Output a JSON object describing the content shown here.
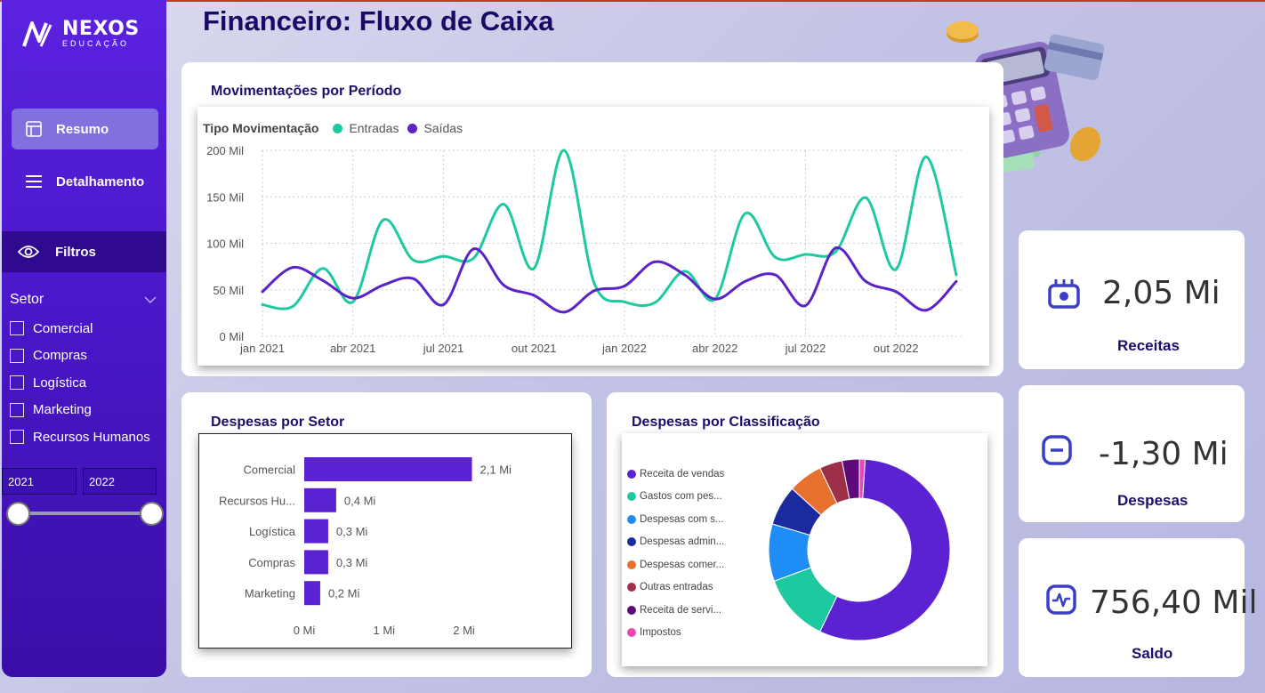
{
  "brand": {
    "name": "NEXOS",
    "sub": "EDUCAÇÃO"
  },
  "page": {
    "title": "Financeiro: Fluxo de Caixa"
  },
  "sidebar": {
    "nav": [
      {
        "label": "Resumo",
        "icon": "layout-icon",
        "active": true
      },
      {
        "label": "Detalhamento",
        "icon": "menu-icon",
        "active": false
      }
    ],
    "filters_label": "Filtros",
    "setor_label": "Setor",
    "setor_options": [
      "Comercial",
      "Compras",
      "Logística",
      "Marketing",
      "Recursos Humanos"
    ],
    "year_from": "2021",
    "year_to": "2022"
  },
  "line_card": {
    "title": "Movimentações por Período",
    "legend_title": "Tipo Movimentação",
    "series_names": [
      "Entradas",
      "Saídas"
    ]
  },
  "bar_card": {
    "title": "Despesas por Setor"
  },
  "donut_card": {
    "title": "Despesas por Classificação"
  },
  "colors": {
    "entradas": "#1ec9a0",
    "saidas": "#5b22c9",
    "bar": "#5b22d1",
    "title": "#1a0a66"
  },
  "kpis": [
    {
      "value": "2,05 Mi",
      "label": "Receitas",
      "icon": "wallet-icon"
    },
    {
      "value": "-1,30 Mi",
      "label": "Despesas",
      "icon": "minus-icon"
    },
    {
      "value": "756,40 Mil",
      "label": "Saldo",
      "icon": "pulse-icon"
    }
  ],
  "chart_data": [
    {
      "type": "line",
      "x": [
        "jan 2021",
        "fev 2021",
        "mar 2021",
        "abr 2021",
        "mai 2021",
        "jun 2021",
        "jul 2021",
        "ago 2021",
        "set 2021",
        "out 2021",
        "nov 2021",
        "dez 2021",
        "jan 2022",
        "fev 2022",
        "mar 2022",
        "abr 2022",
        "mai 2022",
        "jun 2022",
        "jul 2022",
        "ago 2022",
        "set 2022",
        "out 2022",
        "nov 2022",
        "dez 2022"
      ],
      "x_tick_labels": [
        "jan 2021",
        "abr 2021",
        "jul 2021",
        "out 2021",
        "jan 2022",
        "abr 2022",
        "jul 2022",
        "out 2022"
      ],
      "series": [
        {
          "name": "Entradas",
          "color": "#1ec9a0",
          "values": [
            34,
            32,
            73,
            37,
            125,
            82,
            86,
            84,
            142,
            73,
            200,
            57,
            37,
            36,
            70,
            40,
            132,
            85,
            88,
            91,
            149,
            72,
            193,
            66
          ]
        },
        {
          "name": "Saídas",
          "color": "#5b22c9",
          "values": [
            48,
            74,
            60,
            41,
            55,
            62,
            34,
            94,
            55,
            44,
            26,
            49,
            54,
            80,
            66,
            40,
            59,
            66,
            33,
            95,
            59,
            48,
            28,
            59
          ]
        }
      ],
      "y_ticks": [
        "0 Mil",
        "50 Mil",
        "100 Mil",
        "150 Mil",
        "200 Mil"
      ],
      "ylim": [
        0,
        200
      ],
      "grid": true,
      "legend_position": "top-left"
    },
    {
      "type": "bar",
      "orientation": "horizontal",
      "categories": [
        "Comercial",
        "Recursos Hu...",
        "Logística",
        "Compras",
        "Marketing"
      ],
      "values": [
        2.1,
        0.4,
        0.3,
        0.3,
        0.2
      ],
      "data_labels": [
        "2,1 Mi",
        "0,4 Mi",
        "0,3 Mi",
        "0,3 Mi",
        "0,2 Mi"
      ],
      "x_ticks": [
        "0 Mi",
        "1 Mi",
        "2 Mi"
      ],
      "xlim": [
        0,
        2.25
      ]
    },
    {
      "type": "pie",
      "donut": true,
      "categories": [
        "Receita de vendas",
        "Gastos com pes...",
        "Despesas com s...",
        "Despesas admin...",
        "Despesas comer...",
        "Outras entradas",
        "Receita de servi...",
        "Impostos"
      ],
      "values": [
        55,
        12,
        10,
        7,
        6,
        4,
        3,
        1
      ],
      "colors": [
        "#5b22d1",
        "#1ec9a0",
        "#1e8df5",
        "#1b2a9c",
        "#e8702e",
        "#9e2f48",
        "#5e0a7a",
        "#e84ab3"
      ]
    }
  ]
}
